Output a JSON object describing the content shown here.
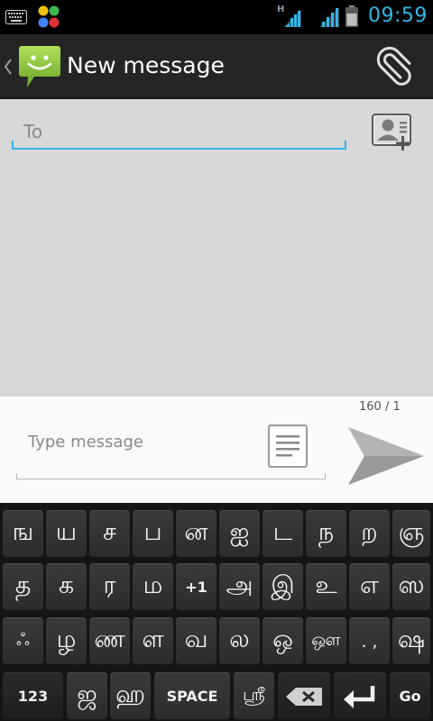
{
  "status_bar": {
    "network_label": "H",
    "time": "09:59",
    "time_color": "#33b5e5"
  },
  "action_bar": {
    "title": "New message",
    "logo_icon": "messaging-icon",
    "attach_icon": "paperclip-icon",
    "logo_color": "#8bc34a"
  },
  "compose": {
    "to_placeholder": "To",
    "contact_icon": "add-contact-icon",
    "counter": "160 / 1",
    "message_placeholder": "Type message",
    "template_icon": "template-icon",
    "send_icon": "send-icon",
    "accent_color": "#33b5e5"
  },
  "keyboard": {
    "row1": [
      "ங",
      "ய",
      "ச",
      "ப",
      "ன",
      "ஐ",
      "ட",
      "ந",
      "ற",
      "ஞ"
    ],
    "row2": [
      "த",
      "க",
      "ர",
      "ம",
      "+1",
      "அ",
      "இ",
      "உ",
      "எ",
      "ஸ"
    ],
    "row3": [
      "ஃ",
      "ழ",
      "ண",
      "ள",
      "வ",
      "ல",
      "ஒ",
      "ஔ",
      ". ,",
      "ஷ"
    ],
    "row4": {
      "numbers": "123",
      "ja": "ஜ",
      "ha": "ஹ",
      "space": "SPACE",
      "shri": "ஸ்ரீ",
      "delete_icon": "backspace-icon",
      "enter_icon": "enter-icon",
      "go": "Go"
    }
  }
}
